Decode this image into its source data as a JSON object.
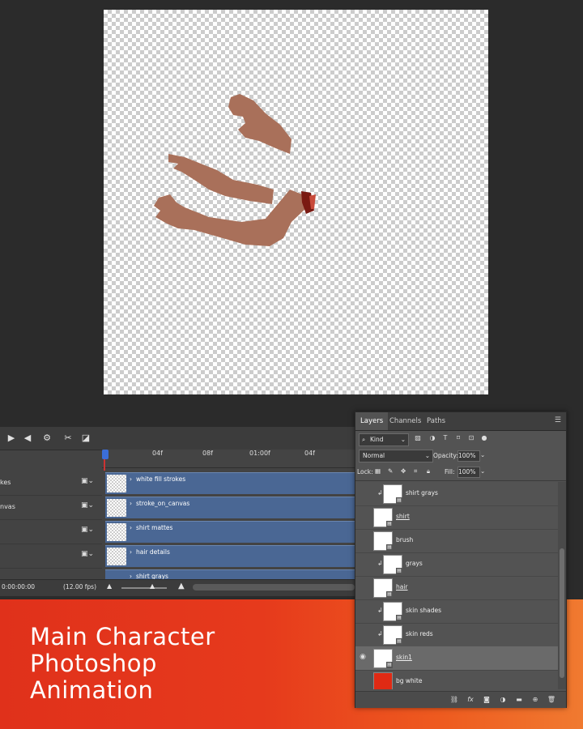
{
  "canvas": {
    "layer_colors": {
      "skin": "#a9705a",
      "accent": "#7a1a12"
    }
  },
  "timeline": {
    "ruler_ticks": [
      "04f",
      "08f",
      "01:00f",
      "04f"
    ],
    "rows": [
      {
        "label": "kes",
        "track": "white fill strokes"
      },
      {
        "label": "nvas",
        "track": "stroke_on_canvas"
      },
      {
        "label": "",
        "track": "shirt mattes"
      },
      {
        "label": "",
        "track": "hair details"
      },
      {
        "label": "",
        "track": "shirt grays"
      }
    ],
    "timecode": "0:00:00:00",
    "fps": "(12.00 fps)",
    "track_color": "#4a6794"
  },
  "layers_panel": {
    "tabs": [
      "Layers",
      "Channels",
      "Paths"
    ],
    "kind_label": "Kind",
    "blend_mode": "Normal",
    "opacity_label": "Opacity:",
    "opacity_value": "100%",
    "lock_label": "Lock:",
    "fill_label": "Fill:",
    "fill_value": "100%",
    "layers": [
      {
        "name": "shirt grays",
        "clipped": true,
        "underline": false,
        "visible": false,
        "selected": false
      },
      {
        "name": "shirt",
        "clipped": false,
        "underline": true,
        "visible": false,
        "selected": false
      },
      {
        "name": "brush",
        "clipped": false,
        "underline": false,
        "visible": false,
        "selected": false
      },
      {
        "name": "grays",
        "clipped": true,
        "underline": false,
        "visible": false,
        "selected": false
      },
      {
        "name": "hair",
        "clipped": false,
        "underline": true,
        "visible": false,
        "selected": false
      },
      {
        "name": "skin shades",
        "clipped": true,
        "underline": false,
        "visible": false,
        "selected": false
      },
      {
        "name": "skin reds",
        "clipped": true,
        "underline": false,
        "visible": false,
        "selected": false
      },
      {
        "name": "skin1",
        "clipped": false,
        "underline": true,
        "visible": true,
        "selected": true
      },
      {
        "name": "bg white",
        "clipped": false,
        "underline": false,
        "visible": false,
        "selected": false
      }
    ],
    "bg_white_color": "#e02a14"
  },
  "banner": {
    "title_lines": [
      "Main Character",
      "Photoshop",
      "Animation"
    ]
  }
}
